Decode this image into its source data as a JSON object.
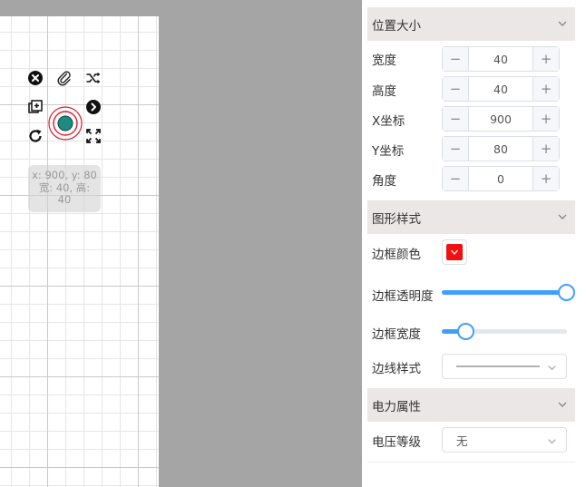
{
  "canvas": {
    "node_info": {
      "coords": "x: 900, y: 80",
      "size_prefix": "宽: 40, 高:",
      "size_suffix": "40"
    },
    "node_color": "#1e8a80",
    "ring_color": "#e0192b"
  },
  "panel": {
    "position_section": {
      "title": "位置大小",
      "fields": [
        {
          "label": "宽度",
          "value": "40"
        },
        {
          "label": "高度",
          "value": "40"
        },
        {
          "label": "X坐标",
          "value": "900"
        },
        {
          "label": "Y坐标",
          "value": "80"
        },
        {
          "label": "角度",
          "value": "0"
        }
      ],
      "minus": "−",
      "plus": "+"
    },
    "style_section": {
      "title": "图形样式",
      "border_color_label": "边框颜色",
      "border_color": "#f20f0f",
      "border_opacity_label": "边框透明度",
      "border_opacity": 1.0,
      "border_width_label": "边框宽度",
      "border_width_fraction": 0.2,
      "line_style_label": "边线样式",
      "line_style_value": "solid"
    },
    "power_section": {
      "title": "电力属性",
      "voltage_label": "电压等级",
      "voltage_value": "无"
    },
    "accent_color": "#409eff"
  }
}
